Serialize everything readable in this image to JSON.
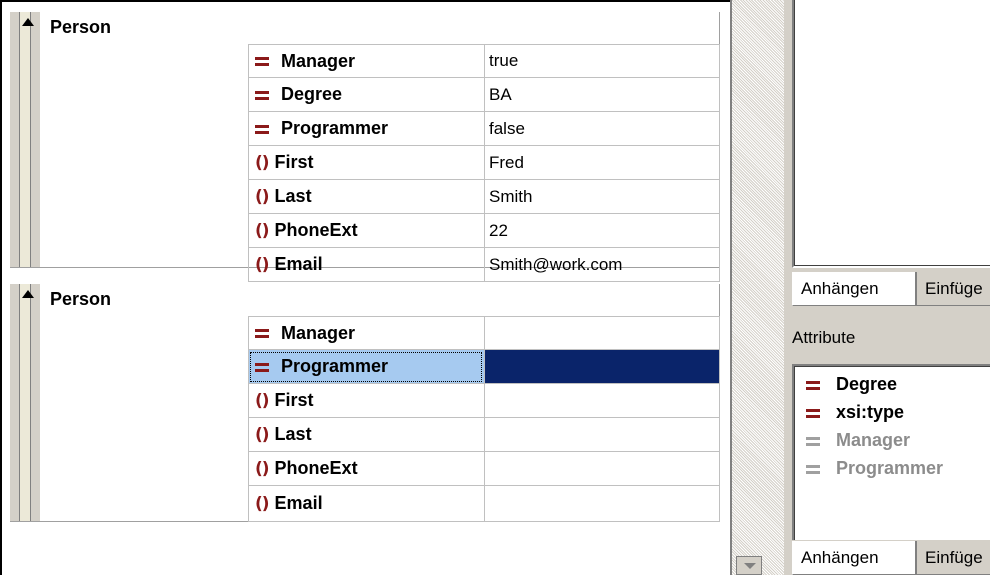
{
  "grid": {
    "groups": [
      {
        "title": "Person",
        "rows": [
          {
            "icon": "attribute-icon",
            "name": "Manager",
            "value": "true"
          },
          {
            "icon": "attribute-icon",
            "name": "Degree",
            "value": "BA"
          },
          {
            "icon": "attribute-icon",
            "name": "Programmer",
            "value": "false"
          },
          {
            "icon": "element-icon",
            "name": "First",
            "value": "Fred"
          },
          {
            "icon": "element-icon",
            "name": "Last",
            "value": "Smith"
          },
          {
            "icon": "element-icon",
            "name": "PhoneExt",
            "value": "22"
          },
          {
            "icon": "element-icon",
            "name": "Email",
            "value": "Smith@work.com"
          }
        ]
      },
      {
        "title": "Person",
        "rows": [
          {
            "icon": "attribute-icon",
            "name": "Manager",
            "value": ""
          },
          {
            "icon": "attribute-icon",
            "name": "Programmer",
            "value": "",
            "selected": true
          },
          {
            "icon": "element-icon",
            "name": "First",
            "value": ""
          },
          {
            "icon": "element-icon",
            "name": "Last",
            "value": ""
          },
          {
            "icon": "element-icon",
            "name": "PhoneExt",
            "value": ""
          },
          {
            "icon": "element-icon",
            "name": "Email",
            "value": ""
          }
        ]
      }
    ]
  },
  "element_glyph": "()",
  "right_panel": {
    "tabs_top": {
      "append": "Anhängen",
      "insert": "Einfüge"
    },
    "attributes_label": "Attribute",
    "attributes": [
      {
        "name": "Degree",
        "enabled": true
      },
      {
        "name": "xsi:type",
        "enabled": true
      },
      {
        "name": "Manager",
        "enabled": false
      },
      {
        "name": "Programmer",
        "enabled": false
      }
    ],
    "tabs_bottom": {
      "append": "Anhängen",
      "insert": "Einfüge"
    }
  },
  "colors": {
    "icon": "#8b1a1a",
    "selection_name": "#a6caf0",
    "selection_value": "#0a246a",
    "panel_bg": "#d4d0c8"
  }
}
